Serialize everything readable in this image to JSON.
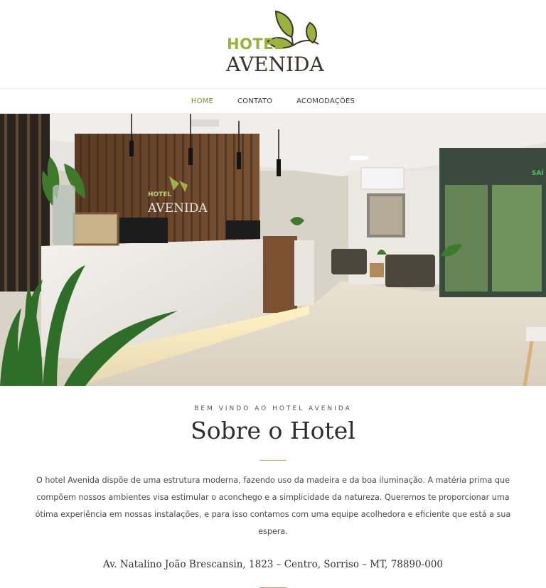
{
  "logo": {
    "hotel": "HOTEL",
    "avenida": "AVENIDA"
  },
  "nav": {
    "home": "HOME",
    "contato": "CONTATO",
    "acomodacoes": "ACOMODAÇÕES"
  },
  "hero": {
    "lobby_logo_hotel": "HOTEL",
    "lobby_logo_avenida": "AVENIDA",
    "exit_sign": "SAÍ"
  },
  "section": {
    "kicker": "BEM VINDO AO HOTEL AVENIDA",
    "title": "Sobre o Hotel",
    "paragraph": "O hotel Avenida dispõe de uma estrutura moderna, fazendo uso da madeira e da boa iluminação. A matéria prima que compõem nossos ambientes visa estimular o aconchego e a simplicidade da natureza. Queremos te proporcionar uma ótima experiência em nossas instalações, e para isso contamos com uma equipe acolhedora e eficiente que está a sua espera.",
    "address": "Av. Natalino João Brescansin, 1823 – Centro, Sorriso – MT, 78890-000"
  },
  "colors": {
    "brand_green": "#9ab23e",
    "nav_active": "#7a8f2a",
    "divider_gold": "#c8a466",
    "brand_dark": "#3b342e"
  }
}
